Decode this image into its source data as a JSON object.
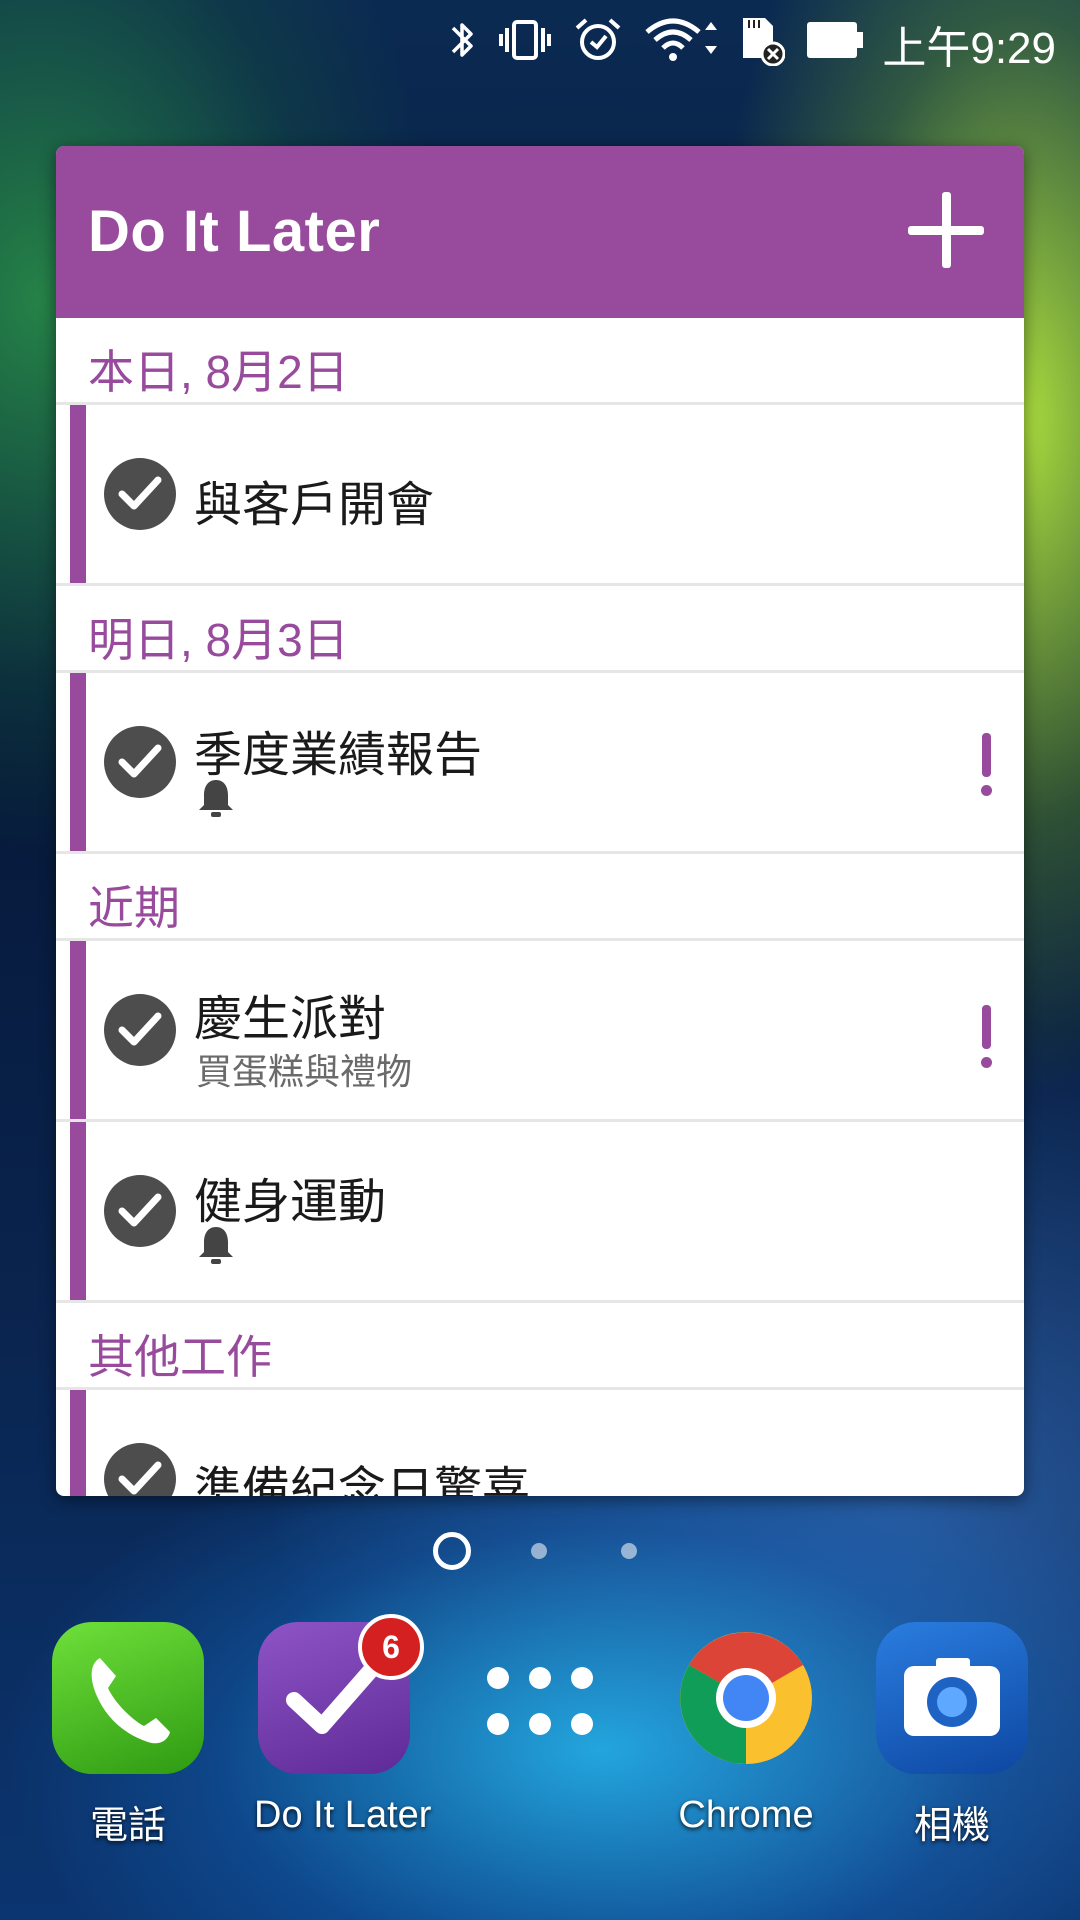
{
  "status_bar": {
    "time": "上午9:29",
    "icons": [
      "bluetooth-icon",
      "vibrate-icon",
      "alarm-icon",
      "wifi-icon",
      "sd-card-icon",
      "battery-icon"
    ]
  },
  "widget": {
    "title": "Do It Later",
    "accent_color": "#984a9c",
    "sections": [
      {
        "header": "本日, 8月2日",
        "tasks": [
          {
            "title": "與客戶開會",
            "subtitle": "",
            "reminder": false,
            "priority": false
          }
        ]
      },
      {
        "header": "明日, 8月3日",
        "tasks": [
          {
            "title": "季度業績報告",
            "subtitle": "",
            "reminder": true,
            "priority": true
          }
        ]
      },
      {
        "header": "近期",
        "tasks": [
          {
            "title": "慶生派對",
            "subtitle": "買蛋糕與禮物",
            "reminder": false,
            "priority": true
          },
          {
            "title": "健身運動",
            "subtitle": "",
            "reminder": true,
            "priority": false
          }
        ]
      },
      {
        "header": "其他工作",
        "tasks": [
          {
            "title": "準備紀念日驚喜",
            "subtitle": "",
            "reminder": false,
            "priority": false
          }
        ]
      }
    ]
  },
  "pager": {
    "current_page": 1,
    "page_count": 3
  },
  "dock": [
    {
      "label": "電話",
      "icon": "phone-icon",
      "color": "#3cb01e"
    },
    {
      "label": "Do It Later",
      "icon": "do-it-later-icon",
      "color": "#7b3fb0",
      "badge": "6"
    },
    {
      "label": "",
      "icon": "app-drawer-icon"
    },
    {
      "label": "Chrome",
      "icon": "chrome-icon"
    },
    {
      "label": "相機",
      "icon": "camera-icon",
      "color": "#1565c0"
    }
  ]
}
